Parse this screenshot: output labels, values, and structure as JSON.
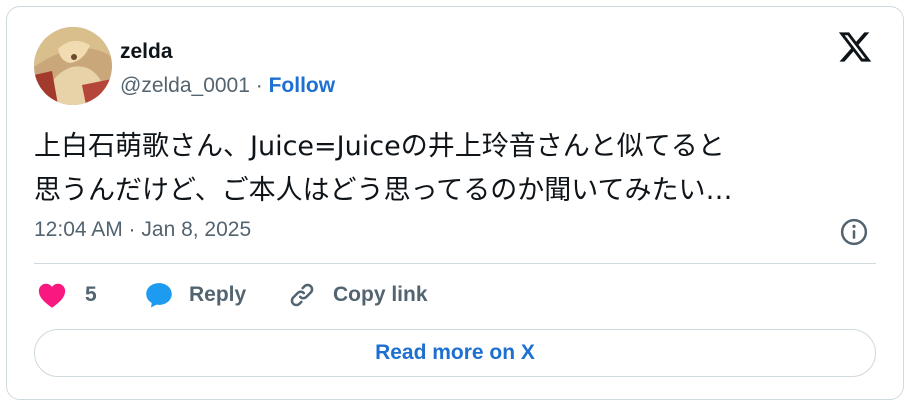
{
  "tweet": {
    "author_name": "zelda",
    "author_handle": "@zelda_0001",
    "separator": " · ",
    "follow_label": "Follow",
    "text_lines": [
      "上白石萌歌さん、Juice=Juiceの井上玲音さんと似てると",
      "思うんだけど、ご本人はどう思ってるのか聞いてみたい…"
    ],
    "timestamp": "12:04 AM · Jan 8, 2025",
    "likes_count": "5",
    "reply_label": "Reply",
    "copy_link_label": "Copy link",
    "read_more_label": "Read more on X"
  },
  "icons": {
    "logo": "x-logo-icon",
    "info": "info-icon",
    "like": "heart-icon",
    "reply": "speech-bubble-icon",
    "copy": "link-icon"
  },
  "colors": {
    "link": "#1d6fd1",
    "heart": "#f91880",
    "reply_bubble": "#1d9bf0",
    "secondary_text": "#536471",
    "border": "#cfd9de"
  }
}
